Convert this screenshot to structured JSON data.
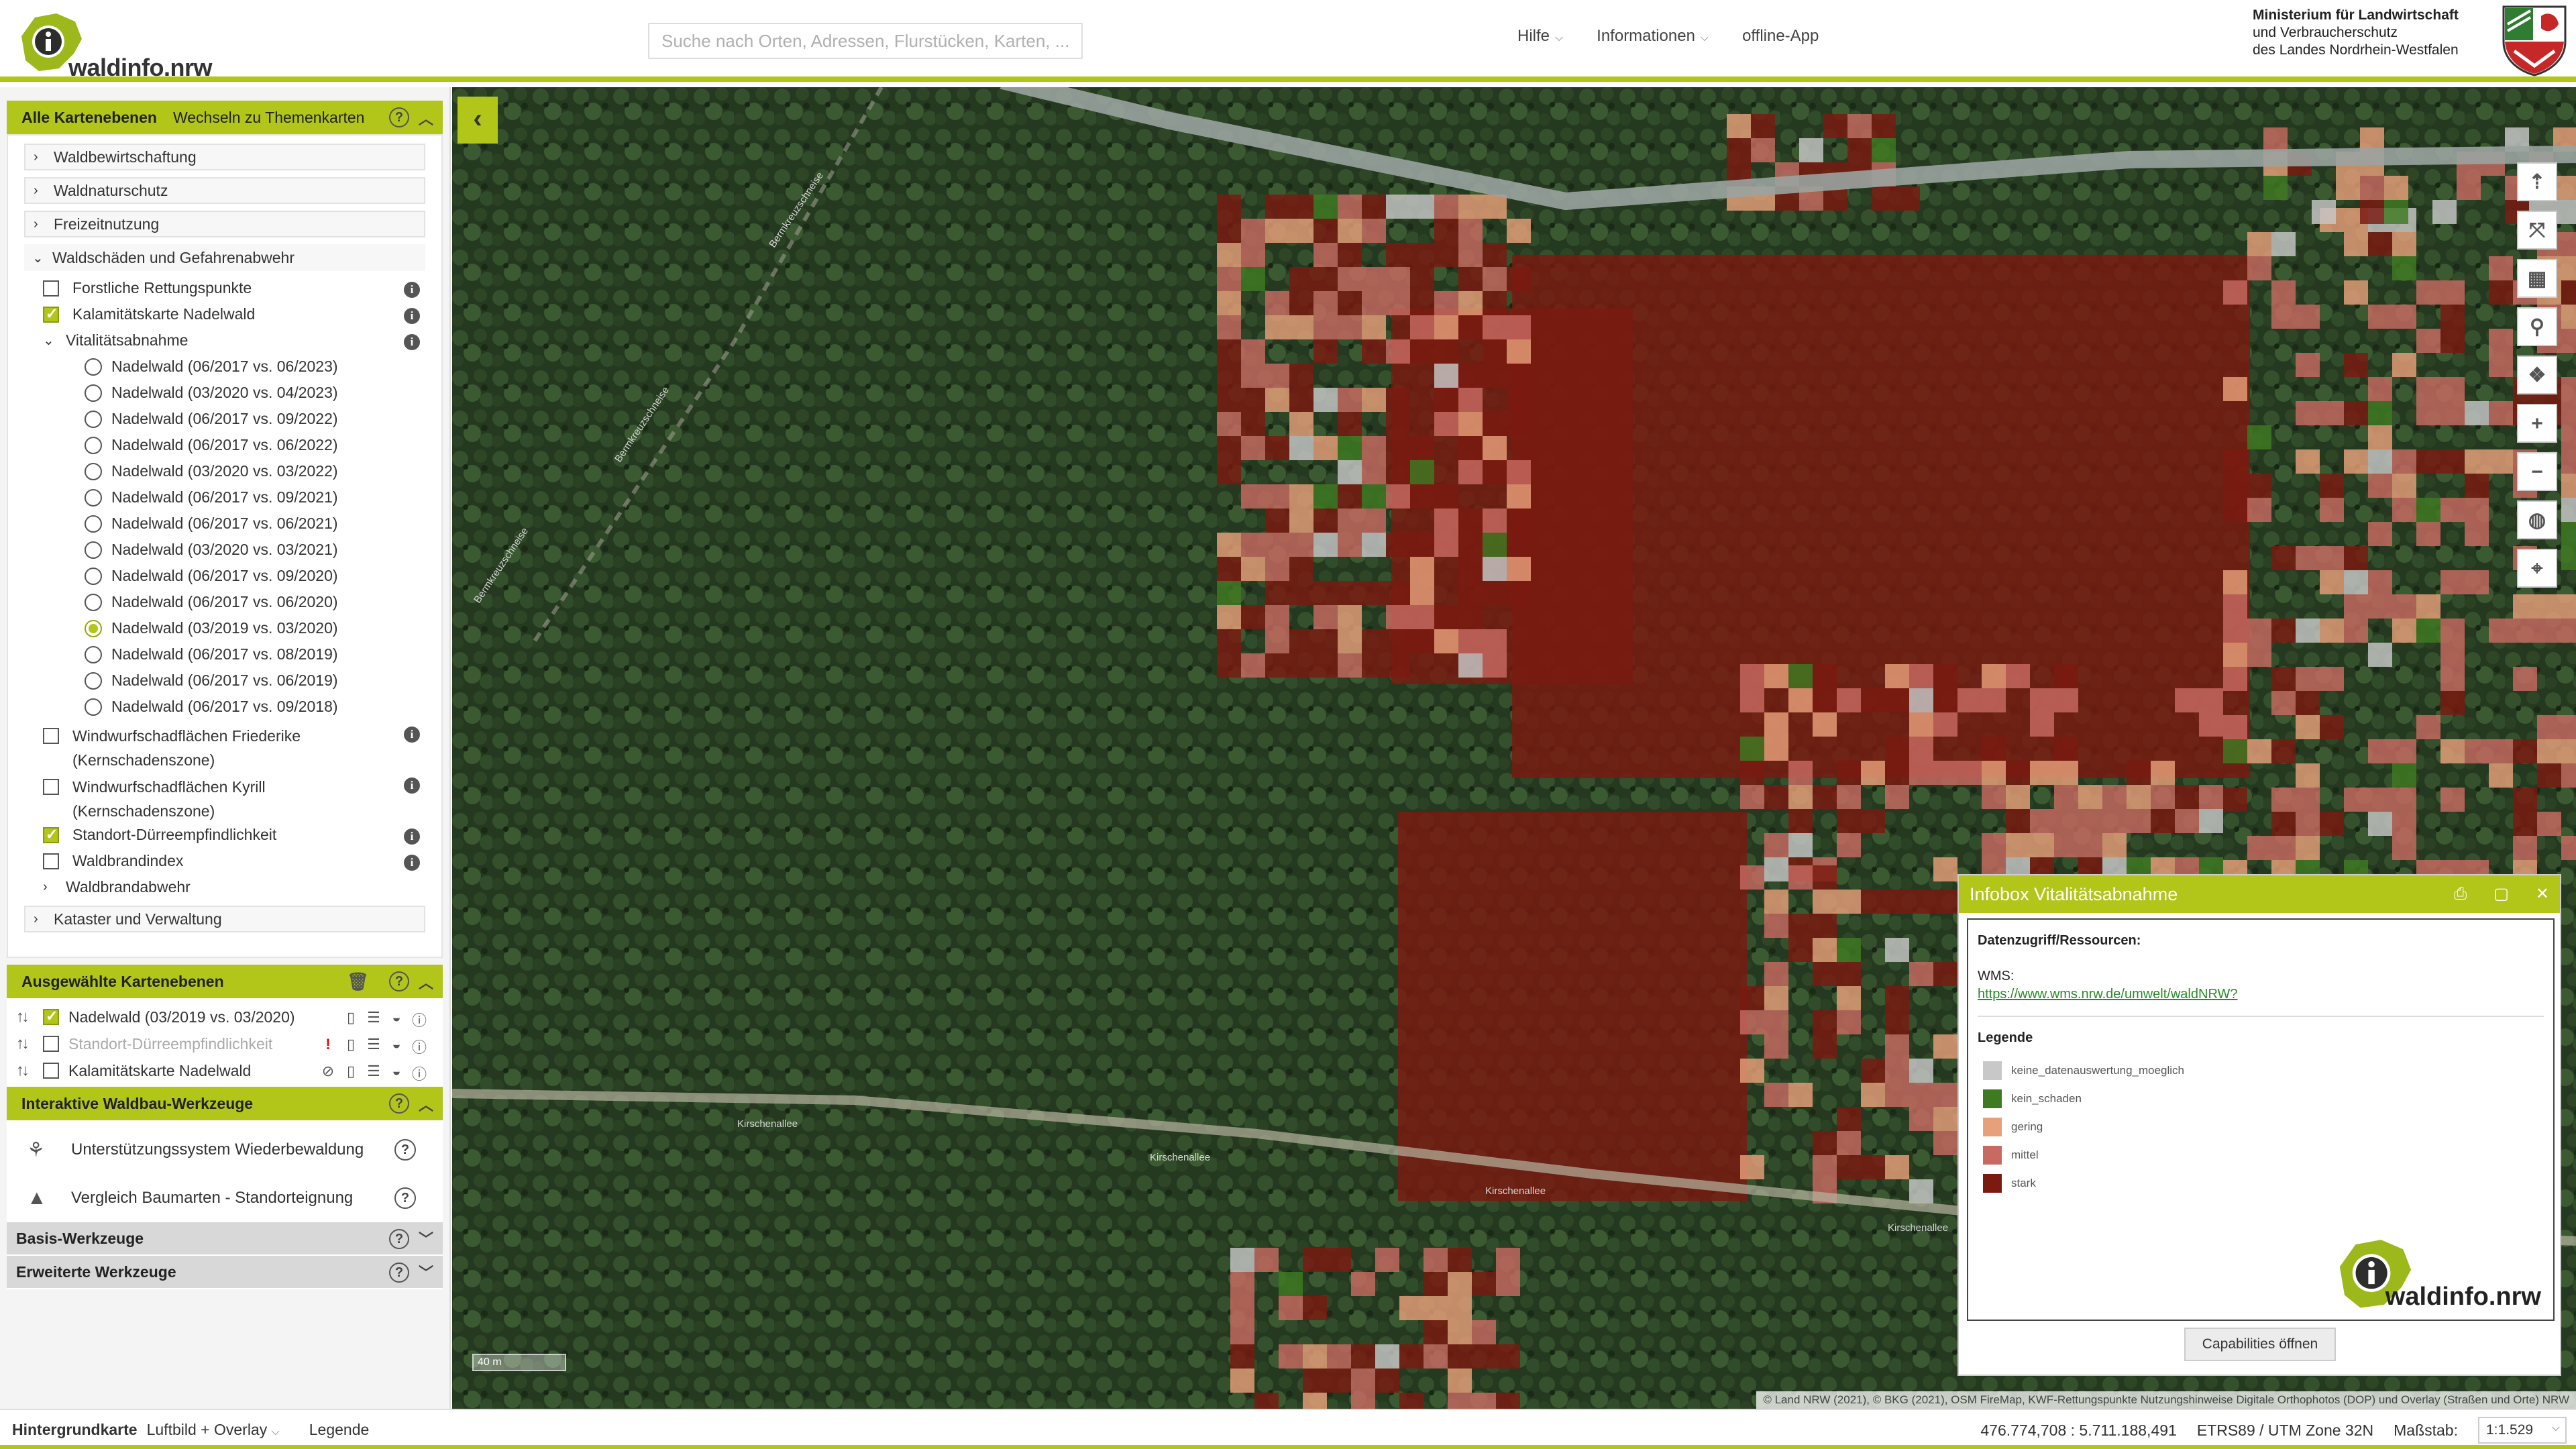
{
  "header": {
    "brand": "waldinfo.nrw",
    "search_placeholder": "Suche nach Orten, Adressen, Flurstücken, Karten, ...",
    "nav": [
      {
        "label": "Hilfe",
        "chevron": true
      },
      {
        "label": "Informationen",
        "chevron": true
      },
      {
        "label": "offline-App",
        "chevron": false
      }
    ],
    "ministry_lines": [
      "Ministerium für Landwirtschaft",
      "und Verbraucherschutz",
      "des Landes Nordrhein-Westfalen"
    ]
  },
  "sidebar": {
    "all_layers": {
      "title": "Alle Kartenebenen",
      "switch_label": "Wechseln zu Themenkarten"
    },
    "categories_top": [
      "Waldbewirtschaftung",
      "Waldnaturschutz",
      "Freizeitnutzung"
    ],
    "open_category": "Waldschäden und Gefahrenabwehr",
    "layers_a": [
      {
        "label": "Forstliche Rettungspunkte",
        "checked": false
      },
      {
        "label": "Kalamitätskarte Nadelwald",
        "checked": true
      }
    ],
    "vitality_group": "Vitalitätsabnahme",
    "vitality_items": [
      {
        "label": "Nadelwald (06/2017 vs. 06/2023)",
        "selected": false
      },
      {
        "label": "Nadelwald (03/2020 vs. 04/2023)",
        "selected": false
      },
      {
        "label": "Nadelwald (06/2017 vs. 09/2022)",
        "selected": false
      },
      {
        "label": "Nadelwald (06/2017 vs. 06/2022)",
        "selected": false
      },
      {
        "label": "Nadelwald (03/2020 vs. 03/2022)",
        "selected": false
      },
      {
        "label": "Nadelwald (06/2017 vs. 09/2021)",
        "selected": false
      },
      {
        "label": "Nadelwald (06/2017 vs. 06/2021)",
        "selected": false
      },
      {
        "label": "Nadelwald (03/2020 vs. 03/2021)",
        "selected": false
      },
      {
        "label": "Nadelwald (06/2017 vs. 09/2020)",
        "selected": false
      },
      {
        "label": "Nadelwald (06/2017 vs. 06/2020)",
        "selected": false
      },
      {
        "label": "Nadelwald (03/2019 vs. 03/2020)",
        "selected": true
      },
      {
        "label": "Nadelwald (06/2017 vs. 08/2019)",
        "selected": false
      },
      {
        "label": "Nadelwald (06/2017 vs. 06/2019)",
        "selected": false
      },
      {
        "label": "Nadelwald (06/2017 vs. 09/2018)",
        "selected": false
      }
    ],
    "layers_b": [
      {
        "line1": "Windwurfschadflächen Friederike",
        "line2": "(Kernschadenszone)",
        "checked": false
      },
      {
        "line1": "Windwurfschadflächen Kyrill",
        "line2": "(Kernschadenszone)",
        "checked": false
      }
    ],
    "layers_c": [
      {
        "label": "Standort-Dürreempfindlichkeit",
        "checked": true
      },
      {
        "label": "Waldbrandindex",
        "checked": false
      }
    ],
    "sub_group": "Waldbrandabwehr",
    "category_bottom": "Kataster und Verwaltung",
    "selected_title": "Ausgewählte Kartenebenen",
    "selected_layers": [
      {
        "label": "Nadelwald (03/2019 vs. 03/2020)",
        "checked": true,
        "dim": false,
        "warn": false,
        "hidden_icon": false
      },
      {
        "label": "Standort-Dürreempfindlichkeit",
        "checked": false,
        "dim": true,
        "warn": true,
        "hidden_icon": false
      },
      {
        "label": "Kalamitätskarte Nadelwald",
        "checked": false,
        "dim": false,
        "warn": false,
        "hidden_icon": true
      }
    ],
    "tools_title": "Interaktive Waldbau-Werkzeuge",
    "tools": [
      {
        "label": "Unterstützungssystem Wiederbewaldung",
        "icon": "seedling-icon"
      },
      {
        "label": "Vergleich Baumarten - Standorteignung",
        "icon": "tree-icon"
      }
    ],
    "basis_title": "Basis-Werkzeuge",
    "erweiterte_title": "Erweiterte Werkzeuge"
  },
  "map": {
    "scale_label": "40 m",
    "attribution": "© Land NRW (2021), © BKG (2021), OSM FireMap, KWF-Rettungspunkte Nutzungshinweise     Digitale Orthophotos (DOP) und Overlay (Straßen und Orte) NRW",
    "road_labels": [
      "Bermkreuzschneise",
      "Bermkreuzschneise",
      "Bermkreuzschneise",
      "Kirschenallee",
      "Kirschenallee",
      "Kirschenallee",
      "Kirschenallee"
    ],
    "controls": [
      "compass-icon",
      "fullscreen-icon",
      "calendar-icon",
      "marker-icon",
      "layers-icon",
      "zoom-in-icon",
      "zoom-out-icon",
      "globe-icon",
      "locate-icon"
    ]
  },
  "infobox": {
    "title": "Infobox Vitalitätsabnahme",
    "section_data": "Datenzugriff/Ressourcen:",
    "wms_label": "WMS:",
    "wms_link": "https://www.wms.nrw.de/umwelt/waldNRW?",
    "legend_title": "Legende",
    "legend": [
      {
        "label": "keine_datenauswertung_moeglich",
        "color": "#c8c8c8"
      },
      {
        "label": "kein_schaden",
        "color": "#3f7a22"
      },
      {
        "label": "gering",
        "color": "#e8a07a"
      },
      {
        "label": "mittel",
        "color": "#c86a62"
      },
      {
        "label": "stark",
        "color": "#7a1a10"
      }
    ],
    "brand": "waldinfo.nrw",
    "button": "Capabilities öffnen"
  },
  "footer": {
    "bg_label": "Hintergrundkarte",
    "bg_value": "Luftbild + Overlay",
    "legend_link": "Legende",
    "coords": "476.774,708 : 5.711.188,491",
    "crs": "ETRS89 / UTM Zone 32N",
    "scale_label": "Maßstab:",
    "scale_value": "1:1.529"
  },
  "colors": {
    "accent": "#b2c61a",
    "stark": "#7a1a10",
    "mittel": "#c86a62",
    "gering": "#e8a07a",
    "kein_schaden": "#3f7a22",
    "keine_daten": "#c8c8c8"
  }
}
